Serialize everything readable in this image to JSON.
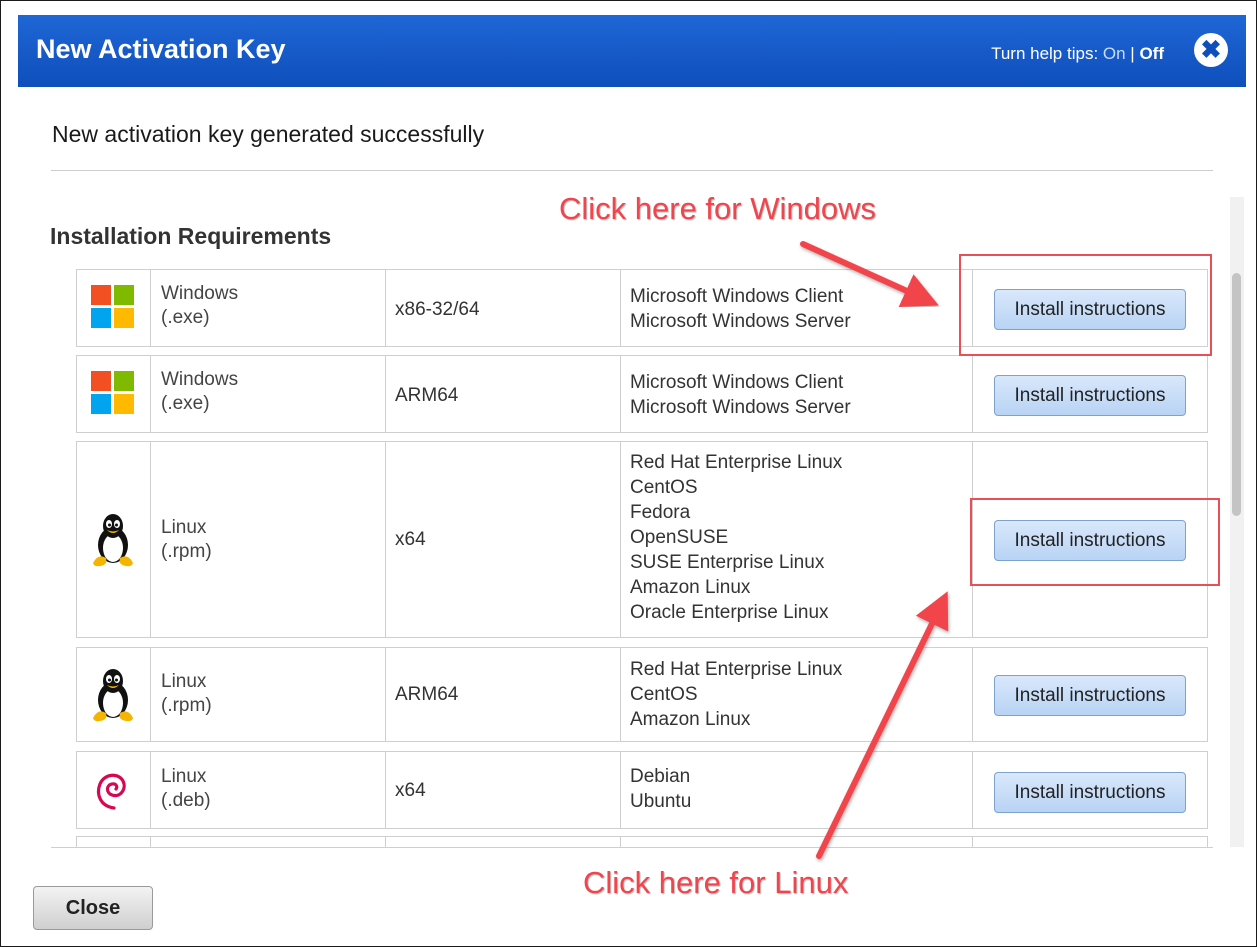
{
  "dialog": {
    "title": "New Activation Key",
    "help_tips_prefix": "Turn help tips: ",
    "help_tips_on": "On",
    "help_tips_separator": " | ",
    "help_tips_off": "Off",
    "close_icon": "close-icon",
    "success_message": "New activation key generated successfully",
    "section_title": "Installation Requirements",
    "close_button": "Close"
  },
  "rows": [
    {
      "icon": "windows-logo-icon",
      "os_name": "Windows",
      "os_ext": "(.exe)",
      "arch": "x86-32/64",
      "dists": [
        "Microsoft Windows Client",
        "Microsoft Windows Server"
      ],
      "button": "Install instructions"
    },
    {
      "icon": "windows-logo-icon",
      "os_name": "Windows",
      "os_ext": "(.exe)",
      "arch": "ARM64",
      "dists": [
        "Microsoft Windows Client",
        "Microsoft Windows Server"
      ],
      "button": "Install instructions"
    },
    {
      "icon": "linux-tux-icon",
      "os_name": "Linux",
      "os_ext": "(.rpm)",
      "arch": "x64",
      "dists": [
        "Red Hat Enterprise Linux",
        "CentOS",
        "Fedora",
        "OpenSUSE",
        "SUSE Enterprise Linux",
        "Amazon Linux",
        "Oracle Enterprise Linux"
      ],
      "button": "Install instructions"
    },
    {
      "icon": "linux-tux-icon",
      "os_name": "Linux",
      "os_ext": "(.rpm)",
      "arch": "ARM64",
      "dists": [
        "Red Hat Enterprise Linux",
        "CentOS",
        "Amazon Linux"
      ],
      "button": "Install instructions"
    },
    {
      "icon": "debian-swirl-icon",
      "os_name": "Linux",
      "os_ext": "(.deb)",
      "arch": "x64",
      "dists": [
        "Debian",
        "Ubuntu"
      ],
      "button": "Install instructions"
    }
  ],
  "annotations": {
    "windows_callout": "Click here for Windows",
    "linux_callout": "Click here for Linux",
    "color": "#f2444c"
  },
  "colors": {
    "titlebar": "#1558c8",
    "button": "#c9ddf7"
  }
}
